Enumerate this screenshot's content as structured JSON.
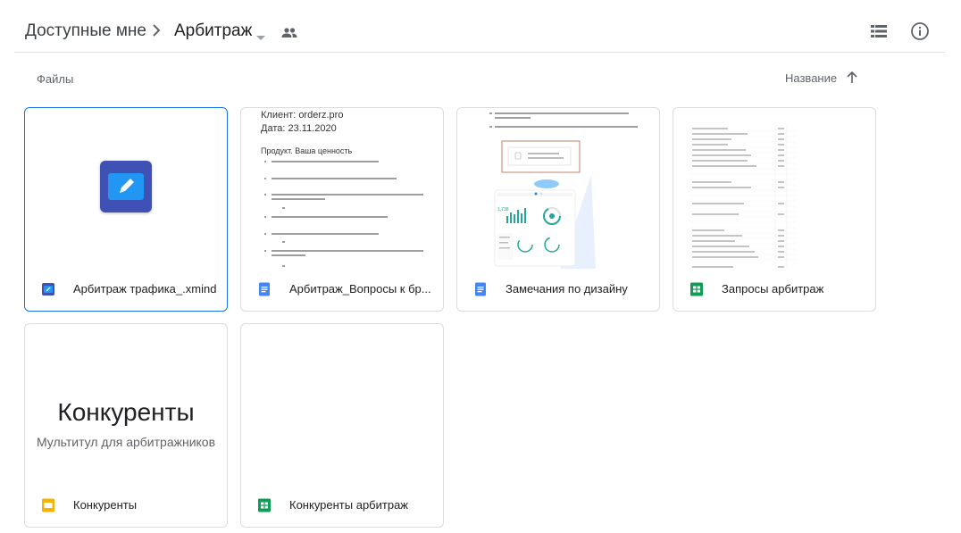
{
  "breadcrumb": {
    "root": "Доступные мне",
    "current": "Арбитраж"
  },
  "toolbar": {
    "list_view_icon": "list-view-icon",
    "info_icon": "info-icon"
  },
  "section": {
    "title": "Файлы",
    "sort_label": "Название"
  },
  "colors": {
    "docs_blue": "#4285f4",
    "sheets_green": "#0f9d58",
    "slides_yellow": "#f4b400",
    "xmind_indigo": "#3f51b5",
    "selected_border": "#1a73e8"
  },
  "files": [
    {
      "name": "Арбитраж трафика_.xmind",
      "type": "xmind",
      "icon": "xmind-icon"
    },
    {
      "name": "Арбитраж_Вопросы к бр...",
      "type": "docs",
      "icon": "docs-icon",
      "preview": {
        "line1": "Клиент: orderz.pro",
        "line2": "Дата: 23.11.2020",
        "line3": "Продукт. Ваша ценность"
      }
    },
    {
      "name": "Замечания по дизайну",
      "type": "docs",
      "icon": "docs-icon"
    },
    {
      "name": "Запросы арбитраж",
      "type": "sheets",
      "icon": "sheets-icon"
    },
    {
      "name": "Конкуренты",
      "type": "slides",
      "icon": "slides-icon",
      "preview": {
        "title": "Конкуренты",
        "subtitle": "Мультитул для арбитражников"
      }
    },
    {
      "name": "Конкуренты арбитраж",
      "type": "sheets",
      "icon": "sheets-icon"
    }
  ]
}
